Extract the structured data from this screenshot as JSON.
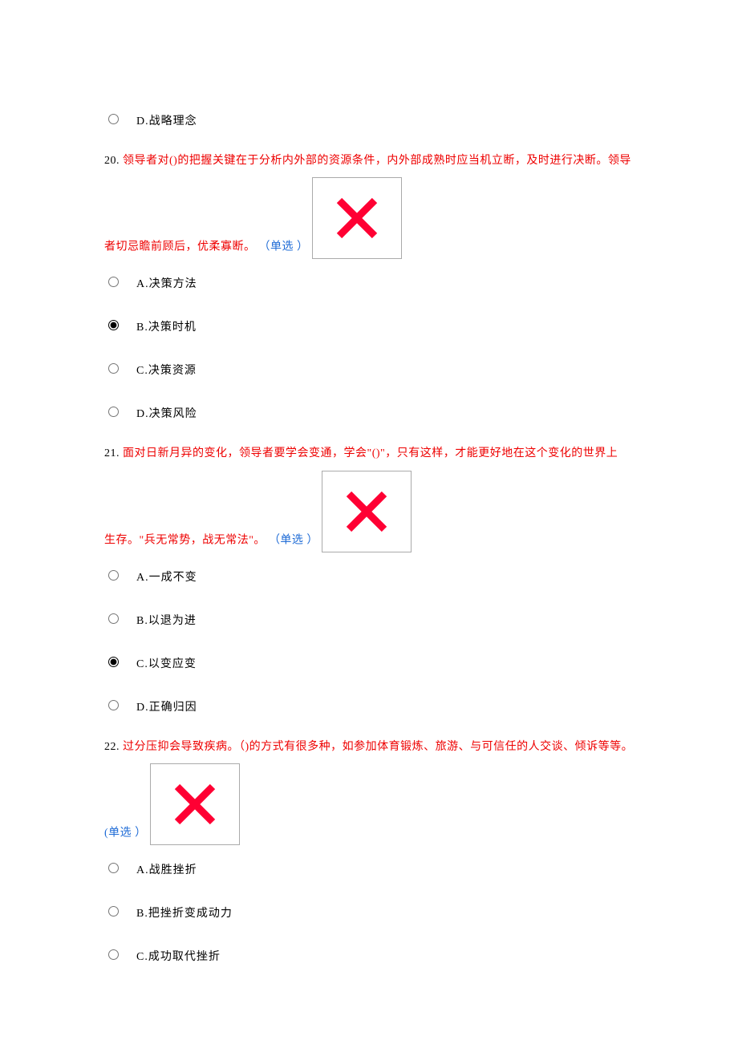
{
  "tail_option": {
    "label": "D.战略理念"
  },
  "questions": [
    {
      "num": "20.",
      "text_part1": "领导者对()的把握关键在于分析内外部的资源条件，内外部成熟时应当机立断，及时进行决断。领导",
      "text_part2": "者切忌瞻前顾后，优柔寡断。",
      "tag": "（单选 ）",
      "options": [
        {
          "label": "A.决策方法",
          "selected": false
        },
        {
          "label": "B.决策时机",
          "selected": true
        },
        {
          "label": "C.决策资源",
          "selected": false
        },
        {
          "label": "D.决策风险",
          "selected": false
        }
      ]
    },
    {
      "num": "21.",
      "text_part1": "面对日新月异的变化，领导者要学会变通，学会\"()\"，只有这样，才能更好地在这个变化的世界上",
      "text_part2": "生存。\"兵无常势，战无常法\"。",
      "tag": "（单选 ）",
      "options": [
        {
          "label": "A.一成不变",
          "selected": false
        },
        {
          "label": "B.以退为进",
          "selected": false
        },
        {
          "label": "C.以变应变",
          "selected": true
        },
        {
          "label": "D.正确归因",
          "selected": false
        }
      ]
    },
    {
      "num": "22.",
      "text_part1": "过分压抑会导致疾病。（)的方式有很多种，如参加体育锻炼、旅游、与可信任的人交谈、倾诉等等。",
      "text_part2": "",
      "tag": "(单选 ）",
      "options": [
        {
          "label": "A.战胜挫折",
          "selected": false
        },
        {
          "label": "B.把挫折变成动力",
          "selected": false
        },
        {
          "label": "C.成功取代挫折",
          "selected": false
        }
      ]
    }
  ]
}
